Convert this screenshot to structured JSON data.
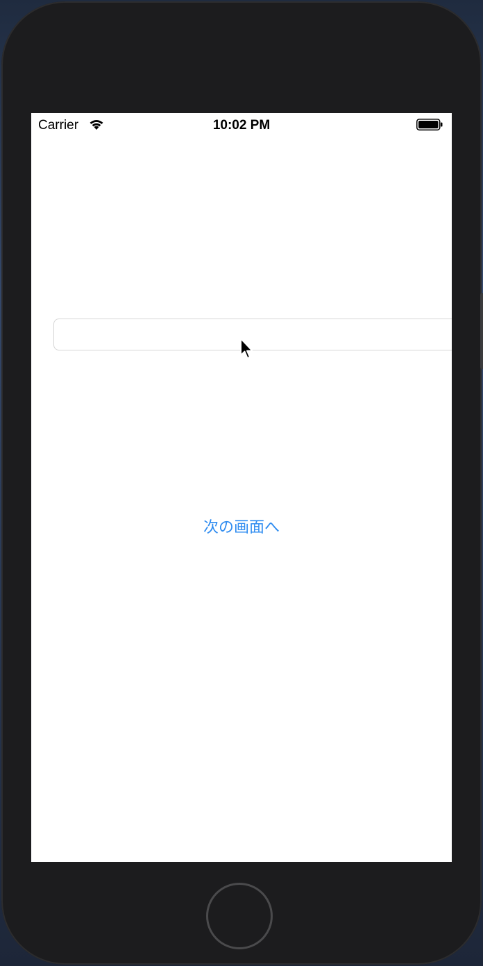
{
  "status_bar": {
    "carrier": "Carrier",
    "time": "10:02 PM",
    "wifi_icon": "wifi-icon",
    "battery_icon": "battery-full-icon"
  },
  "main": {
    "text_field": {
      "value": "",
      "placeholder": ""
    },
    "next_button_label": "次の画面へ"
  },
  "colors": {
    "accent": "#2f8cf0",
    "device_frame": "#1c1c1e",
    "screen_background": "#ffffff"
  }
}
